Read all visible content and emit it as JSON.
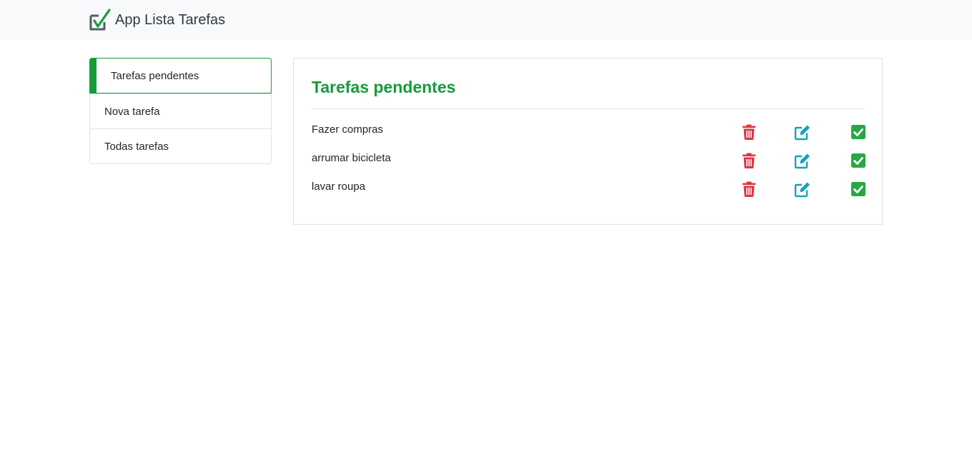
{
  "app": {
    "brand": "App Lista Tarefas",
    "brand_icon": "checkbox-check-icon",
    "accent_color": "#179b3a"
  },
  "sidebar": {
    "items": [
      {
        "label": "Tarefas pendentes",
        "active": true
      },
      {
        "label": "Nova tarefa",
        "active": false
      },
      {
        "label": "Todas tarefas",
        "active": false
      }
    ]
  },
  "main": {
    "title": "Tarefas pendentes",
    "tasks": [
      {
        "name": "Fazer compras"
      },
      {
        "name": "arrumar bicicleta"
      },
      {
        "name": "lavar roupa"
      }
    ],
    "actions": {
      "delete_icon": "trash-icon",
      "delete_color": "#dc3545",
      "edit_icon": "edit-icon",
      "edit_color": "#17a2b8",
      "done_icon": "check-square-icon",
      "done_color": "#28a745"
    }
  }
}
